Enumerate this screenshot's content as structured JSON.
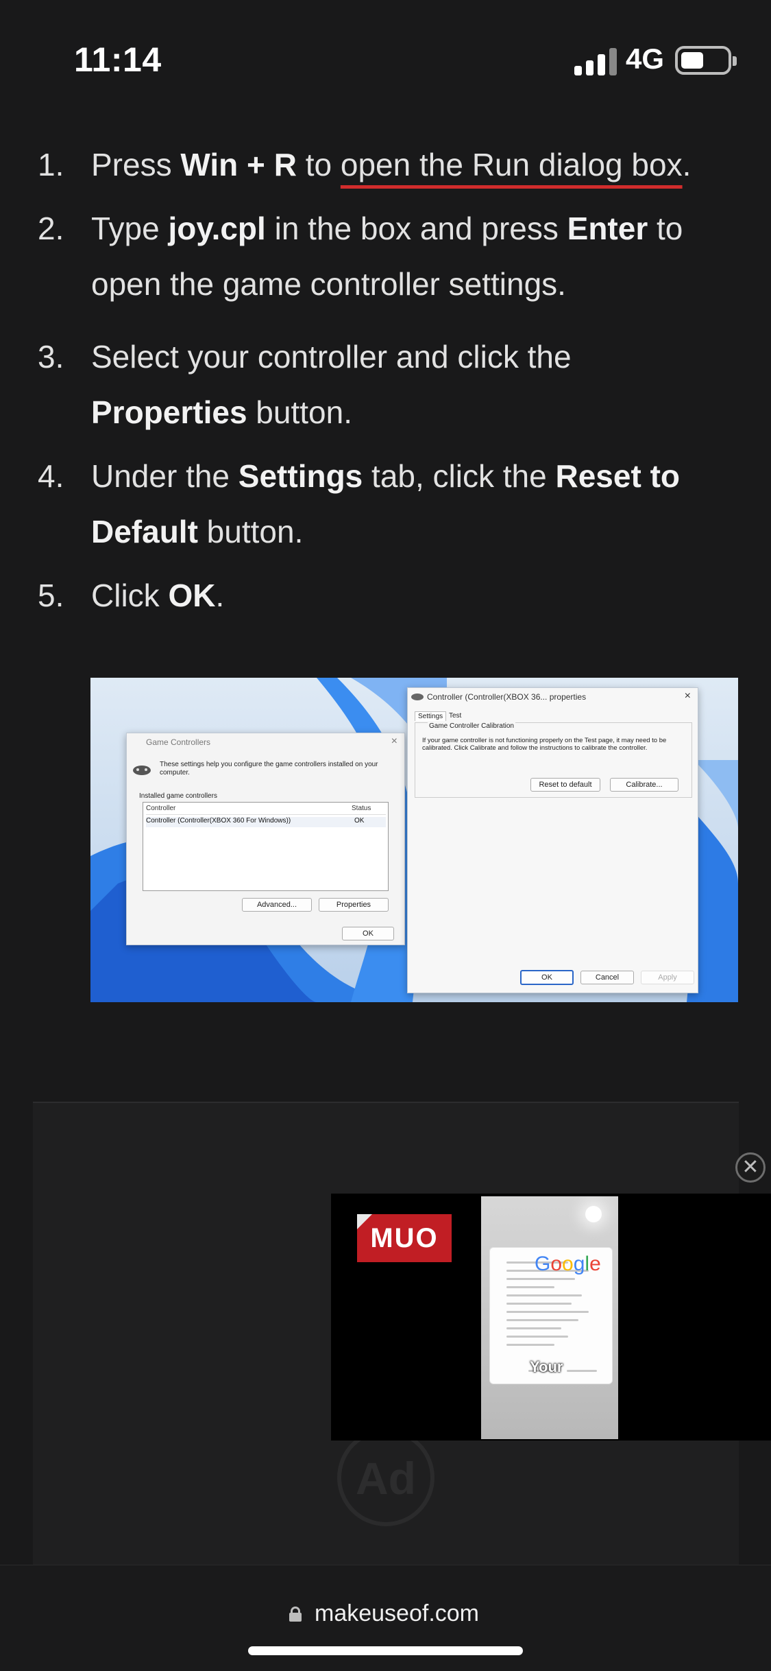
{
  "status_bar": {
    "time": "11:14",
    "network": "4G",
    "signal_bars": 4,
    "battery_level": 0.45
  },
  "steps": [
    {
      "number": "1.",
      "parts": [
        {
          "t": "Press ",
          "b": false
        },
        {
          "t": "Win + R",
          "b": true
        },
        {
          "t": " to ",
          "b": false
        },
        {
          "t": "open the Run dialog box",
          "b": false,
          "link": true
        },
        {
          "t": ".",
          "b": false
        }
      ]
    },
    {
      "number": "2.",
      "parts": [
        {
          "t": "Type ",
          "b": false
        },
        {
          "t": "joy.cpl",
          "b": true
        },
        {
          "t": " in the box and press ",
          "b": false
        },
        {
          "t": "Enter",
          "b": true
        },
        {
          "t": " to open the game controller settings.",
          "b": false
        }
      ]
    },
    {
      "number": "3.",
      "parts": [
        {
          "t": "Select your controller and click the ",
          "b": false
        },
        {
          "t": "Properties",
          "b": true
        },
        {
          "t": " button.",
          "b": false
        }
      ]
    },
    {
      "number": "4.",
      "parts": [
        {
          "t": "Under the ",
          "b": false
        },
        {
          "t": "Settings",
          "b": true
        },
        {
          "t": " tab, click the ",
          "b": false
        },
        {
          "t": "Reset to Default",
          "b": true
        },
        {
          "t": " button.",
          "b": false
        }
      ]
    },
    {
      "number": "5.",
      "parts": [
        {
          "t": "Click ",
          "b": false
        },
        {
          "t": "OK",
          "b": true
        },
        {
          "t": ".",
          "b": false
        }
      ]
    }
  ],
  "screenshot": {
    "game_controllers_dialog": {
      "title": "Game Controllers",
      "description": "These settings help you configure the game controllers installed on your computer.",
      "list_label": "Installed game controllers",
      "columns": [
        "Controller",
        "Status"
      ],
      "rows": [
        {
          "controller": "Controller (Controller(XBOX 360 For Windows))",
          "status": "OK"
        }
      ],
      "advanced_button": "Advanced...",
      "properties_button": "Properties",
      "ok_button": "OK"
    },
    "properties_dialog": {
      "title": "Controller (Controller(XBOX 36... properties",
      "tabs": [
        "Settings",
        "Test"
      ],
      "group_title": "Game Controller Calibration",
      "group_text": "If your game controller is not functioning properly on the Test page, it may need to be calibrated. Click Calibrate and follow the instructions to calibrate the controller.",
      "reset_button": "Reset to default",
      "calibrate_button": "Calibrate...",
      "ok_button": "OK",
      "cancel_button": "Cancel",
      "apply_button": "Apply"
    }
  },
  "ad": {
    "logo_text": "Ad"
  },
  "video": {
    "brand": "MUO",
    "google_logo": [
      "G",
      "o",
      "o",
      "g",
      "l",
      "e"
    ],
    "caption": "Your",
    "close_glyph": "✕"
  },
  "address_bar": {
    "domain": "makeuseof.com"
  },
  "colors": {
    "background": "#19191a",
    "link_underline": "#d12c2c",
    "muo_red": "#c11e24"
  }
}
